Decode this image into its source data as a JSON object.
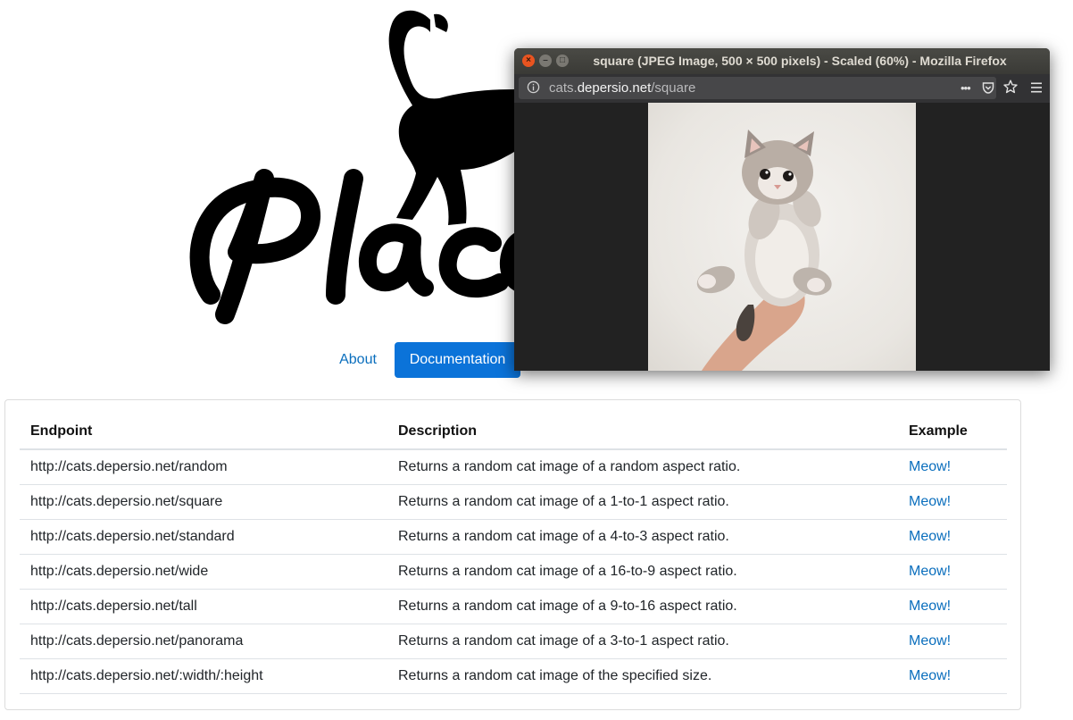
{
  "nav": {
    "about": "About",
    "documentation": "Documentation"
  },
  "table": {
    "headers": [
      "Endpoint",
      "Description",
      "Example"
    ],
    "rows": [
      {
        "endpoint": "http://cats.depersio.net/random",
        "description": "Returns a random cat image of a random aspect ratio.",
        "example": "Meow!"
      },
      {
        "endpoint": "http://cats.depersio.net/square",
        "description": "Returns a random cat image of a 1-to-1 aspect ratio.",
        "example": "Meow!"
      },
      {
        "endpoint": "http://cats.depersio.net/standard",
        "description": "Returns a random cat image of a 4-to-3 aspect ratio.",
        "example": "Meow!"
      },
      {
        "endpoint": "http://cats.depersio.net/wide",
        "description": "Returns a random cat image of a 16-to-9 aspect ratio.",
        "example": "Meow!"
      },
      {
        "endpoint": "http://cats.depersio.net/tall",
        "description": "Returns a random cat image of a 9-to-16 aspect ratio.",
        "example": "Meow!"
      },
      {
        "endpoint": "http://cats.depersio.net/panorama",
        "description": "Returns a random cat image of a 3-to-1 aspect ratio.",
        "example": "Meow!"
      },
      {
        "endpoint": "http://cats.depersio.net/:width/:height",
        "description": "Returns a random cat image of the specified size.",
        "example": "Meow!"
      }
    ]
  },
  "firefox": {
    "title": "square (JPEG Image, 500 × 500 pixels) - Scaled (60%) - Mozilla Firefox",
    "url_prefix": "cats.",
    "url_host": "depersio.net",
    "url_path": "/square",
    "more_actions": "•••",
    "colors": {
      "titlebar": "#3f3f3b",
      "close": "#e95420",
      "viewer_bg": "#222222"
    }
  },
  "icons": [
    "info-icon",
    "pocket-icon",
    "star-icon",
    "hamburger-menu-icon",
    "close-icon",
    "minimize-icon",
    "maximize-icon"
  ],
  "colors": {
    "link": "#0a6ebd",
    "primary_button": "#0b73d9"
  }
}
